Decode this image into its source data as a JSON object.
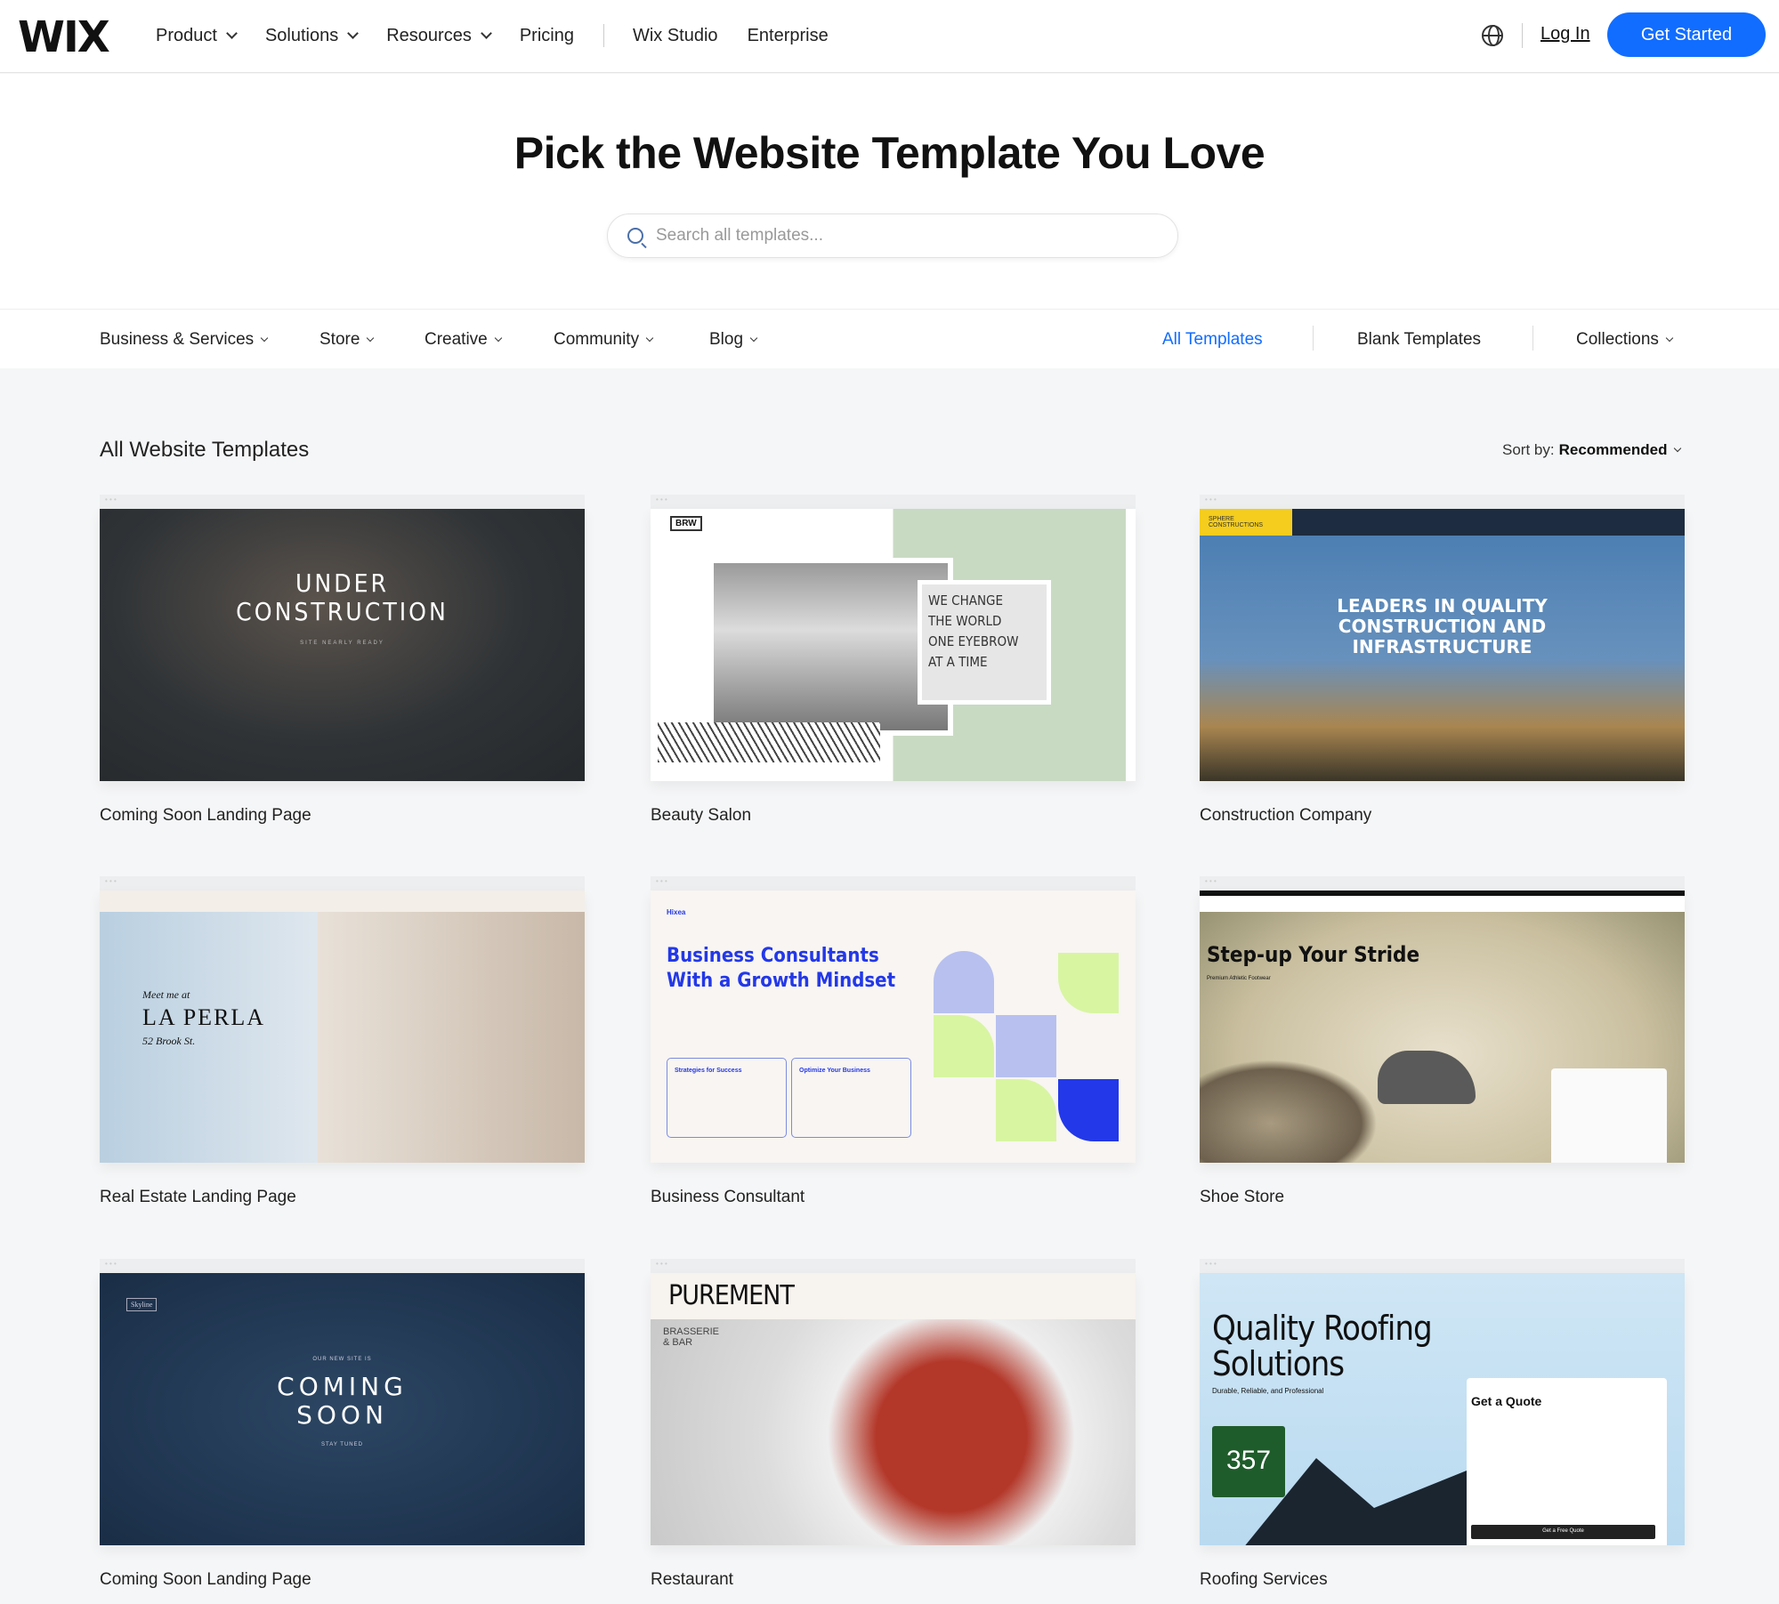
{
  "header": {
    "logo": "WIX",
    "nav": [
      {
        "label": "Product",
        "dropdown": true
      },
      {
        "label": "Solutions",
        "dropdown": true
      },
      {
        "label": "Resources",
        "dropdown": true
      },
      {
        "label": "Pricing"
      },
      {
        "label": "Wix Studio"
      },
      {
        "label": "Enterprise"
      }
    ],
    "globe_icon": "globe-icon",
    "login": "Log In",
    "get_started": "Get Started",
    "accent": "#116dff"
  },
  "hero": {
    "title": "Pick the Website Template You Love",
    "search_placeholder": "Search all templates..."
  },
  "filters": {
    "left": [
      "Business & Services",
      "Store",
      "Creative",
      "Community",
      "Blog"
    ],
    "all": "All Templates",
    "blank": "Blank Templates",
    "collections": "Collections",
    "active_color": "#116dff"
  },
  "section": {
    "title": "All Website Templates",
    "sort_label": "Sort by:",
    "sort_value": "Recommended"
  },
  "templates": [
    {
      "name": "Coming Soon Landing Page",
      "headline": "UNDER\nCONSTRUCTION",
      "sub": "SITE NEARLY READY"
    },
    {
      "name": "Beauty Salon",
      "logo": "BRW",
      "headline": "WE CHANGE\nTHE WORLD\nONE EYEBROW\nAT A TIME"
    },
    {
      "name": "Construction Company",
      "logo": "SPHERE CONSTRUCTIONS",
      "headline": "LEADERS IN QUALITY\nCONSTRUCTION AND\nINFRASTRUCTURE"
    },
    {
      "name": "Real Estate Landing Page",
      "kicker": "Meet me at",
      "headline": "LA PERLA",
      "sub": "52 Brook St."
    },
    {
      "name": "Business Consultant",
      "logo": "Hixea",
      "headline": "Business Consultants\nWith a Growth Mindset",
      "cards": [
        "Strategies for Success",
        "Optimize Your Business"
      ]
    },
    {
      "name": "Shoe Store",
      "headline": "Step-up Your Stride",
      "sub": "Premium Athletic Footwear"
    },
    {
      "name": "Coming Soon Landing Page",
      "logo": "Skyline",
      "kicker": "OUR NEW SITE IS",
      "headline": "COMING\nSOON",
      "sub": "STAY TUNED"
    },
    {
      "name": "Restaurant",
      "headline": "PUREMENT",
      "sub": "BRASSERIE\n& BAR"
    },
    {
      "name": "Roofing Services",
      "headline": "Quality Roofing\nSolutions",
      "sub": "Durable, Reliable, and Professional",
      "form_title": "Get a Quote",
      "badge": "357",
      "button": "Get a Free Quote"
    }
  ]
}
